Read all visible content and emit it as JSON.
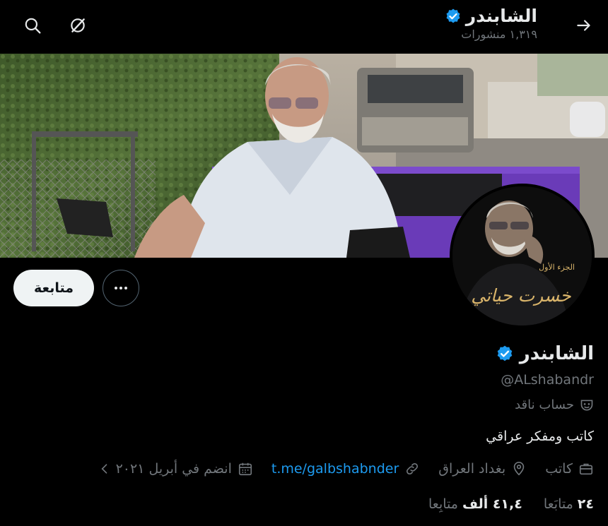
{
  "header": {
    "name": "الشابندر",
    "posts": "١,٣١٩ منشورات"
  },
  "profile": {
    "name": "الشابندر",
    "handle": "@ALshabandr",
    "label": "حساب ناقد",
    "bio": "كاتب ومفكر عراقي",
    "follow_label": "متابعة",
    "avatar_text": "خسرت حياتي",
    "avatar_small_text": "الجزء الأول"
  },
  "meta": {
    "joined": "انضم في أبريل ٢٠٢١",
    "link": "t.me/galbshabnder",
    "location": "بغداد العراق",
    "profession": "كاتب"
  },
  "stats": {
    "following_count": "٢٤",
    "following_label": "متابَعا",
    "followers_count": "٤١,٤ ألف",
    "followers_label": "متابِعا"
  },
  "colors": {
    "accent": "#1d9bf0",
    "verified": "#1d9bf0",
    "muted": "#71767b"
  }
}
